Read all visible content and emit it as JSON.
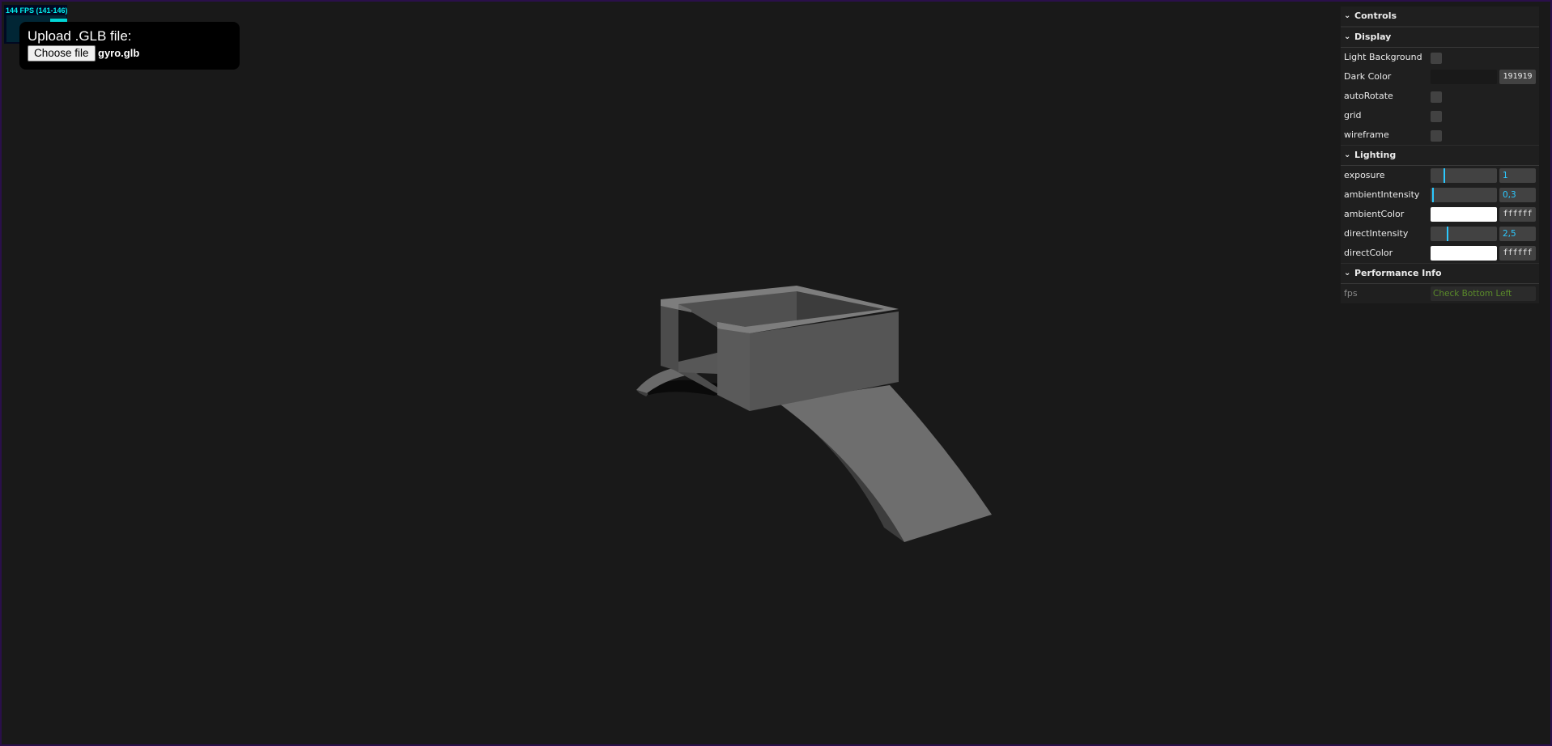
{
  "upload": {
    "label": "Upload .GLB file:",
    "button_label": "Choose file",
    "file_name": "gyro.glb"
  },
  "stats": {
    "text": "144 FPS (141-146)",
    "fps": 144
  },
  "gui": {
    "title": "Controls",
    "display": {
      "title": "Display",
      "light_background_label": "Light Background",
      "light_background_checked": false,
      "dark_color_label": "Dark Color",
      "dark_color_value": "191919",
      "dark_color_hex": "#191919",
      "auto_rotate_label": "autoRotate",
      "auto_rotate_checked": false,
      "grid_label": "grid",
      "grid_checked": false,
      "wireframe_label": "wireframe",
      "wireframe_checked": false
    },
    "lighting": {
      "title": "Lighting",
      "exposure_label": "exposure",
      "exposure_value": "1",
      "exposure_fraction": 0.2,
      "ambient_intensity_label": "ambientIntensity",
      "ambient_intensity_value": "0,3",
      "ambient_intensity_fraction": 0.03,
      "ambient_color_label": "ambientColor",
      "ambient_color_value": "ffffff",
      "ambient_color_hex": "#ffffff",
      "direct_intensity_label": "directIntensity",
      "direct_intensity_value": "2,5",
      "direct_intensity_fraction": 0.25,
      "direct_color_label": "directColor",
      "direct_color_value": "ffffff",
      "direct_color_hex": "#ffffff"
    },
    "performance": {
      "title": "Performance Info",
      "fps_label": "fps",
      "fps_value": "Check Bottom Left"
    }
  },
  "colors": {
    "background": "#191919",
    "accent": "#2cc9ff",
    "stats_text": "#00ffff",
    "border": "#2a0f4a"
  }
}
